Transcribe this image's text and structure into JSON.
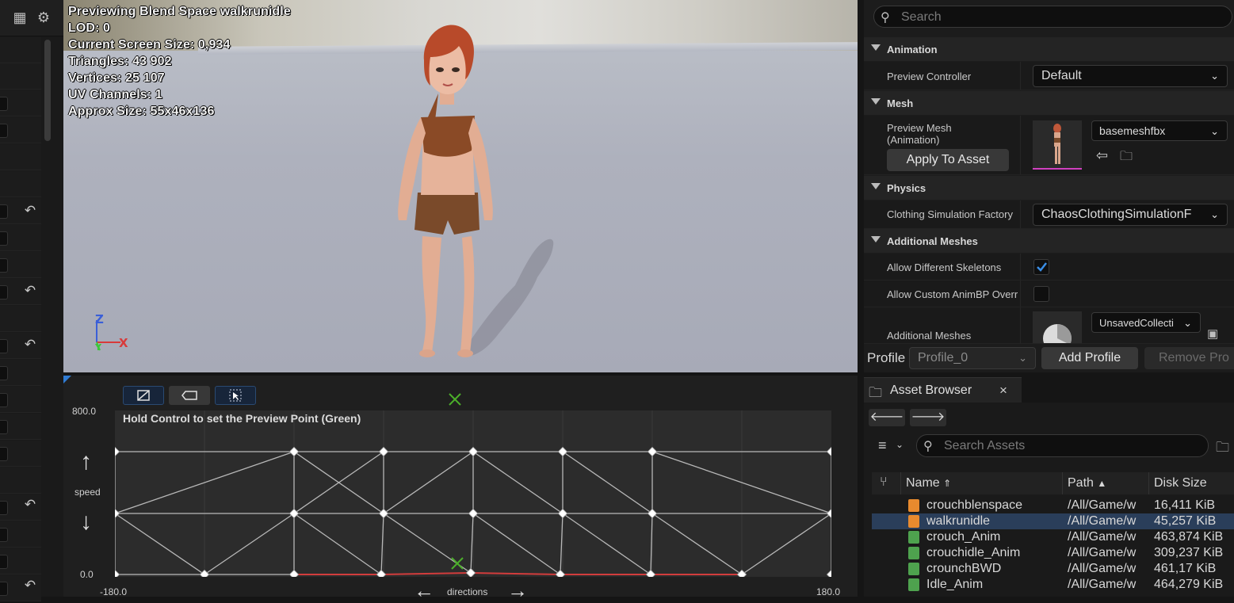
{
  "viewport": {
    "stats": [
      "Previewing Blend Space walkrunidle",
      "LOD: 0",
      "Current Screen Size: 0,934",
      "Triangles: 43 902",
      "Vertices: 25 107",
      "UV Channels: 1",
      "Approx Size: 55x46x136"
    ],
    "axes": {
      "z": "Z",
      "x": "X",
      "y": "Y"
    }
  },
  "blendspace": {
    "hint": "Hold Control to set the Preview Point (Green)",
    "y_axis": {
      "name": "speed",
      "max": "800.0",
      "min": "0.0"
    },
    "x_axis": {
      "name": "directions",
      "min": "-180.0",
      "max": "180.0"
    },
    "tools": [
      "grid-icon",
      "eraser-icon",
      "select-icon"
    ]
  },
  "details": {
    "search_placeholder": "Search",
    "categories": {
      "animation": "Animation",
      "mesh": "Mesh",
      "physics": "Physics",
      "additional_meshes": "Additional Meshes"
    },
    "props": {
      "preview_controller": {
        "label": "Preview Controller",
        "value": "Default"
      },
      "preview_mesh": {
        "label": "Preview Mesh (Animation)",
        "value": "basemeshfbx",
        "apply": "Apply To Asset"
      },
      "clothing": {
        "label": "Clothing Simulation Factory",
        "value": "ChaosClothingSimulationF"
      },
      "allow_skeletons": {
        "label": "Allow Different Skeletons",
        "checked": true
      },
      "allow_animbp": {
        "label": "Allow Custom AnimBP Overric",
        "checked": false
      },
      "additional_meshes": {
        "label": "Additional Meshes",
        "value": "UnsavedCollecti"
      }
    },
    "profile": {
      "label": "Profile",
      "value": "Profile_0",
      "add": "Add Profile",
      "remove": "Remove Pro"
    }
  },
  "asset_browser": {
    "tab": "Asset Browser",
    "search_placeholder": "Search Assets",
    "columns": {
      "name": "Name",
      "path": "Path",
      "size": "Disk Size"
    },
    "rows": [
      {
        "name": "crouchblenspace",
        "path": "/All/Game/w",
        "size": "16,411 KiB",
        "type": "blendspace",
        "selected": false
      },
      {
        "name": "walkrunidle",
        "path": "/All/Game/w",
        "size": "45,257 KiB",
        "type": "blendspace",
        "selected": true
      },
      {
        "name": "crouch_Anim",
        "path": "/All/Game/w",
        "size": "463,874 KiB",
        "type": "anim",
        "selected": false
      },
      {
        "name": "crouchidle_Anim",
        "path": "/All/Game/w",
        "size": "309,237 KiB",
        "type": "anim",
        "selected": false
      },
      {
        "name": "crounchBWD",
        "path": "/All/Game/w",
        "size": "461,17 KiB",
        "type": "anim",
        "selected": false
      },
      {
        "name": "Idle_Anim",
        "path": "/All/Game/w",
        "size": "464,279 KiB",
        "type": "anim",
        "selected": false
      }
    ]
  },
  "colors": {
    "accent": "#2f7bd3",
    "selected_row": "#2a3e5a",
    "blendspace_icon": "#e88a2e",
    "anim_icon": "#4ea24e",
    "preview_point": "#4caf2a",
    "path_line": "#d23c3c"
  }
}
